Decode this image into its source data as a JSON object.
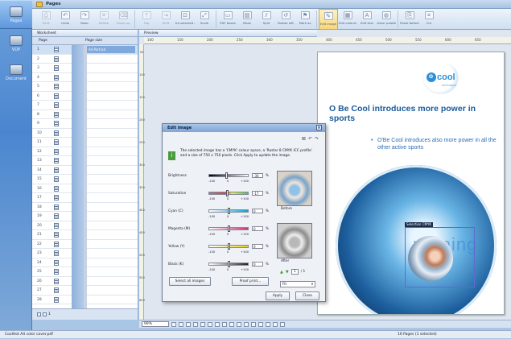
{
  "app": {
    "title": "Pages"
  },
  "nav": [
    {
      "label": "Pages",
      "icon": "pages-icon"
    },
    {
      "label": "VDP",
      "icon": "vdp-icon"
    },
    {
      "label": "Document",
      "icon": "document-icon"
    }
  ],
  "toolbar": [
    {
      "label": "Print",
      "icon": "print-icon"
    },
    {
      "label": "Undo",
      "icon": "undo-icon"
    },
    {
      "label": "Redo",
      "icon": "redo-icon"
    },
    {
      "label": "Delete",
      "icon": "delete-icon"
    },
    {
      "label": "Clean-up",
      "icon": "clean-up-icon"
    },
    {
      "label": "Top",
      "icon": "top-icon"
    },
    {
      "label": "Shift",
      "icon": "shift-icon"
    },
    {
      "label": "Centre selected area",
      "icon": "centre-icon"
    },
    {
      "label": "Scale",
      "icon": "scale-icon"
    },
    {
      "label": "PDF boxes",
      "icon": "pdf-boxes-icon"
    },
    {
      "label": "Mask",
      "icon": "mask-icon"
    },
    {
      "label": "Split",
      "icon": "split-icon"
    },
    {
      "label": "Rotate left",
      "icon": "rotate-left-icon"
    },
    {
      "label": "Mark as",
      "icon": "mark-as-icon"
    },
    {
      "label": "Edit image",
      "icon": "edit-image-icon"
    },
    {
      "label": "Edit colours",
      "icon": "edit-colours-icon"
    },
    {
      "label": "Edit text",
      "icon": "edit-text-icon"
    },
    {
      "label": "Colour palette",
      "icon": "colour-palette-icon"
    },
    {
      "label": "Paste before",
      "icon": "paste-before-icon"
    },
    {
      "label": "Cro",
      "icon": "crop-icon"
    }
  ],
  "left_panel": {
    "tab": "Worksheet",
    "col_page": "Page",
    "col_pagesize": "Page size",
    "selected_row_text": "A4 Portrait",
    "pages": [
      "1",
      "2",
      "3",
      "4",
      "5",
      "6",
      "7",
      "8",
      "9",
      "10",
      "11",
      "12",
      "13",
      "14",
      "15",
      "16",
      "17",
      "18",
      "19",
      "20",
      "21",
      "22",
      "23",
      "24",
      "25",
      "26",
      "27",
      "28"
    ],
    "footer_value": "1"
  },
  "preview": {
    "tab": "Preview",
    "ruler_h": [
      "100",
      "150",
      "200",
      "250",
      "300",
      "350",
      "400",
      "450",
      "500",
      "550",
      "600",
      "650"
    ],
    "ruler_v": [
      "50",
      "100",
      "150",
      "200",
      "250",
      "300",
      "350",
      "400",
      "450",
      "500",
      "550",
      "600"
    ]
  },
  "document": {
    "logo_text": "cool",
    "logo_prefix": "O",
    "logo_tagline": "beverages",
    "heading": "O Be Cool introduces more power in sports",
    "bullet": "O'Be Cool introduces also more power in all the other active sports",
    "selection_label": "Selection CMYK",
    "wordmark": "running"
  },
  "dialog": {
    "title": "Edit image",
    "info": "The selected image has a 'CMYK' colour space, a 'Rastar 8 CMYK ICC profile' and a size of 750 x 750 pixels. Click Apply to update the image.",
    "adjustments": [
      {
        "label": "Brightness",
        "value": "-30",
        "scale": [
          "-100",
          "0",
          "+100"
        ],
        "level": -30
      },
      {
        "label": "Saturation",
        "value": "-17",
        "scale": [
          "-100",
          "0",
          "+100"
        ],
        "level": -17
      },
      {
        "label": "Cyan (C)",
        "value": "0",
        "scale": [
          "-100",
          "0",
          "+100"
        ],
        "level": 0,
        "color": "#00a6d6"
      },
      {
        "label": "Magenta (M)",
        "value": "0",
        "scale": [
          "-100",
          "0",
          "+100"
        ],
        "level": 0,
        "color": "#d0307a"
      },
      {
        "label": "Yellow (Y)",
        "value": "0",
        "scale": [
          "-100",
          "0",
          "+100"
        ],
        "level": 0,
        "color": "#e0cc20"
      },
      {
        "label": "Black (K)",
        "value": "0",
        "scale": [
          "-100",
          "0",
          "+100"
        ],
        "level": 0,
        "color": "#222222"
      }
    ],
    "before_label": "Before",
    "after_label": "After",
    "page_value": "1",
    "page_total": "/ 1",
    "zoom_value": "Fit",
    "buttons": {
      "select_all": "Select all images",
      "proof": "Proof print...",
      "apply": "Apply",
      "close": "Close"
    }
  },
  "preview_toolbar": {
    "zoom": "99%"
  },
  "status": {
    "left": "CoolHot A4 color cover.pdf",
    "right": "16 Pages (1 selected)"
  }
}
